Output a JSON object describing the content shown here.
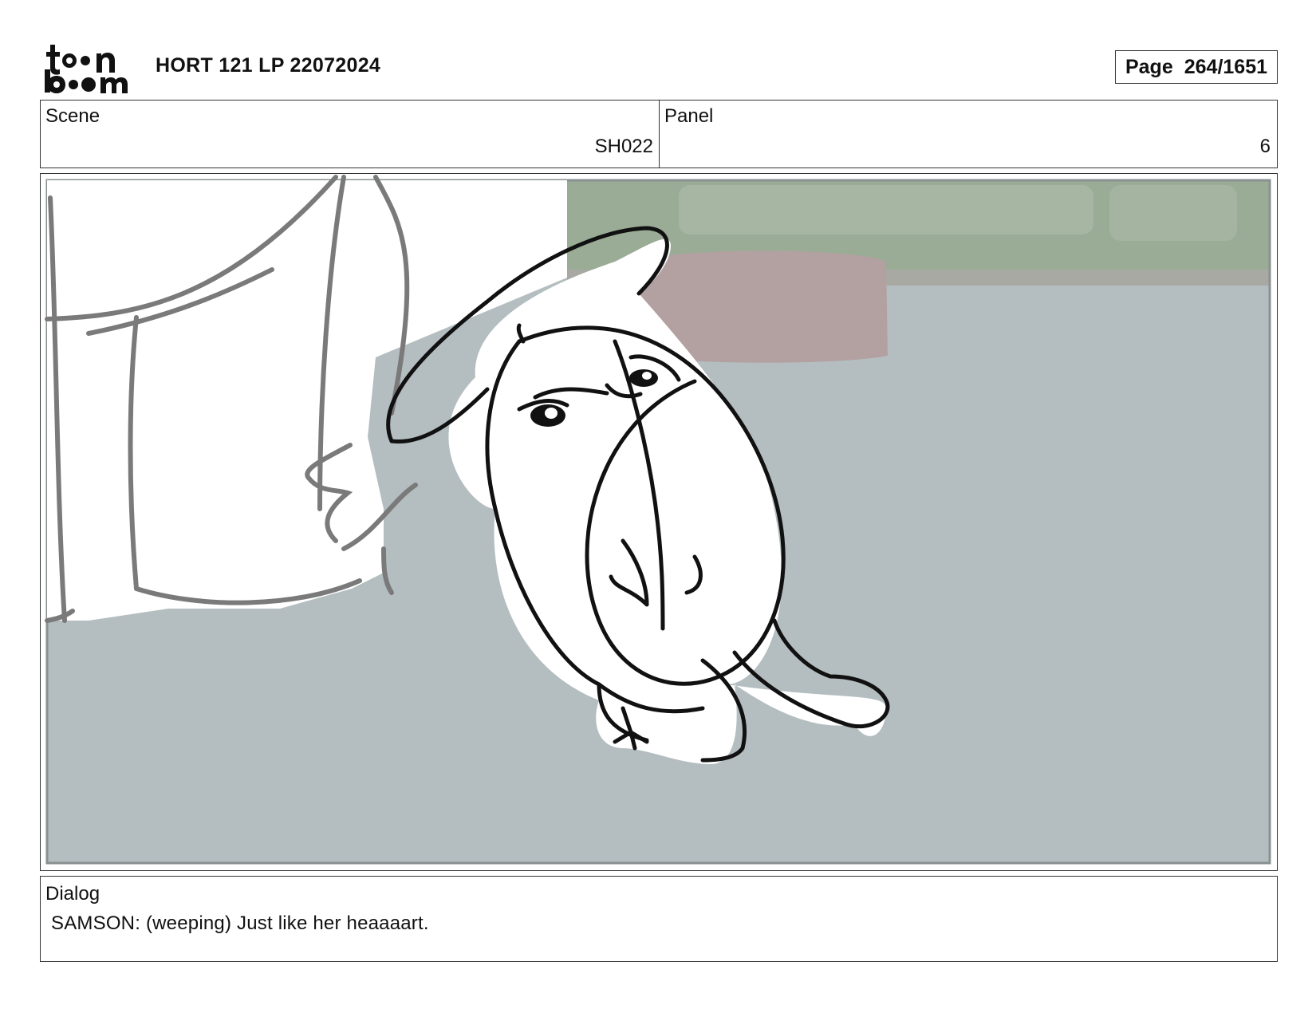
{
  "logo": {
    "text": "toonboom",
    "alt": "toon boom logo"
  },
  "header": {
    "title": "HORT 121 LP 22072024",
    "page_label": "Page",
    "page_value": "264/1651"
  },
  "scene": {
    "label": "Scene",
    "value": "SH022"
  },
  "panel": {
    "label": "Panel",
    "value": "6"
  },
  "dialog": {
    "label": "Dialog",
    "text": "SAMSON: (weeping) Just like her heaaaart."
  },
  "colors": {
    "floor": "#b4bec0",
    "wall": "#8fa48a",
    "cushion": "#b39f9f",
    "line": "#111111",
    "rough_line": "#7a7a7a"
  }
}
